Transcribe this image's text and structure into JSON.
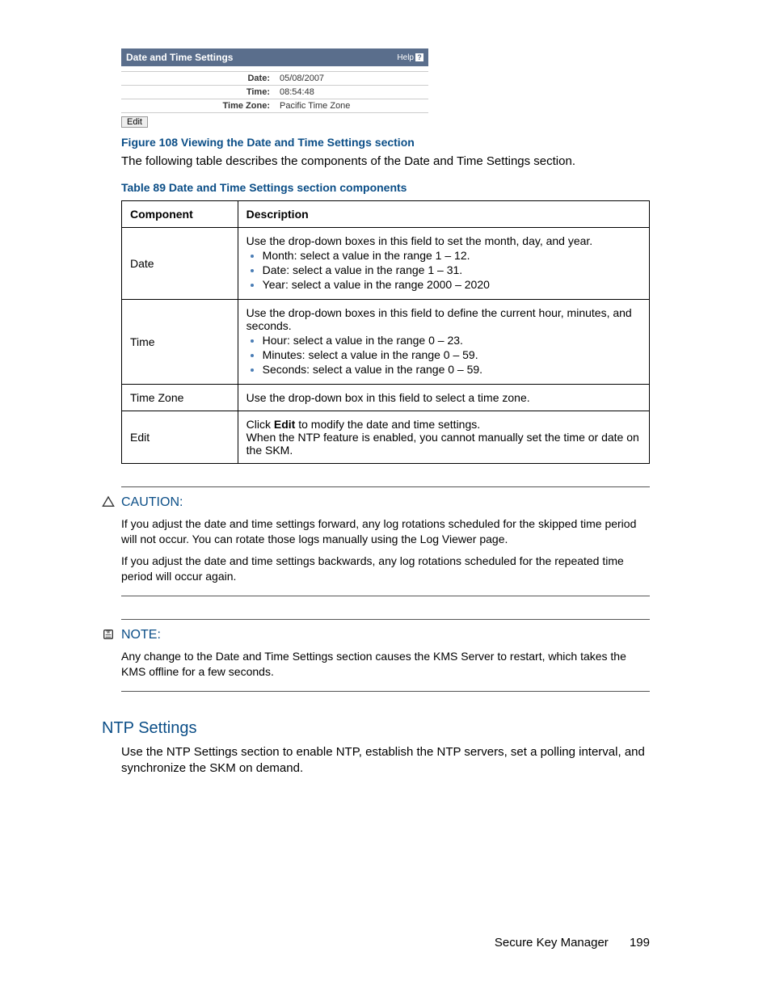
{
  "screenshot": {
    "title": "Date and Time Settings",
    "help": "Help",
    "rows": [
      {
        "label": "Date:",
        "value": "05/08/2007"
      },
      {
        "label": "Time:",
        "value": "08:54:48"
      },
      {
        "label": "Time Zone:",
        "value": "Pacific Time Zone"
      }
    ],
    "edit_btn": "Edit"
  },
  "figure_caption": "Figure 108 Viewing the Date and Time Settings section",
  "intro_text": "The following table describes the components of the Date and Time Settings section.",
  "table_caption": "Table 89 Date and Time Settings section components",
  "table": {
    "head_component": "Component",
    "head_description": "Description",
    "date_label": "Date",
    "date_intro": "Use the drop-down boxes in this field to set the month, day, and year.",
    "date_li1": "Month: select a value in the range 1 – 12.",
    "date_li2": "Date: select a value in the range 1 – 31.",
    "date_li3": "Year: select a value in the range 2000 – 2020",
    "time_label": "Time",
    "time_intro": "Use the drop-down boxes in this field to define the current hour, minutes, and seconds.",
    "time_li1": "Hour: select a value in the range 0 – 23.",
    "time_li2": "Minutes: select a value in the range 0 – 59.",
    "time_li3": "Seconds: select a value in the range 0 – 59.",
    "tz_label": "Time Zone",
    "tz_desc": "Use the drop-down box in this field to select a time zone.",
    "edit_label": "Edit",
    "edit_pre": "Click ",
    "edit_bold": "Edit",
    "edit_post": " to modify the date and time settings.",
    "edit_p2": "When the NTP feature is enabled, you cannot manually set the time or date on the SKM."
  },
  "caution": {
    "title": "CAUTION:",
    "p1": "If you adjust the date and time settings forward, any log rotations scheduled for the skipped time period will not occur. You can rotate those logs manually using the Log Viewer page.",
    "p2": "If you adjust the date and time settings backwards, any log rotations scheduled for the repeated time period will occur again."
  },
  "note": {
    "title": "NOTE:",
    "p1": "Any change to the Date and Time Settings section causes the KMS Server to restart, which takes the KMS offline for a few seconds."
  },
  "ntp": {
    "heading": "NTP Settings",
    "body": "Use the NTP Settings section to enable NTP, establish the NTP servers, set a polling interval, and synchronize the SKM on demand."
  },
  "footer": {
    "product": "Secure Key Manager",
    "page": "199"
  }
}
